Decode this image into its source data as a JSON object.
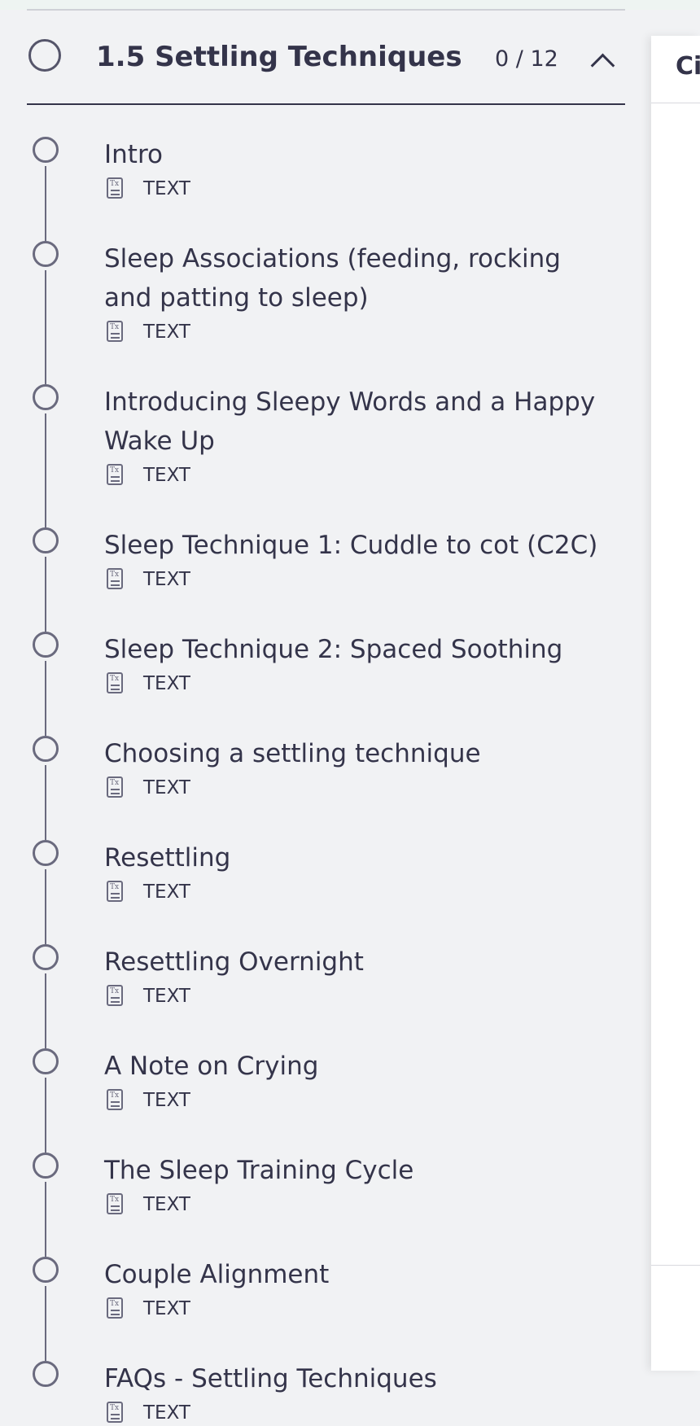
{
  "section": {
    "title": "1.5 Settling Techniques",
    "progress": "0 / 12",
    "progress_completed": 0,
    "progress_total": 12,
    "expanded": true
  },
  "right_panel": {
    "title_partial": "Ci"
  },
  "lessons": [
    {
      "title": "Intro",
      "type": "TEXT"
    },
    {
      "title": "Sleep Associations (feeding, rocking and patting to sleep)",
      "type": "TEXT"
    },
    {
      "title": "Introducing Sleepy Words and a Happy Wake Up",
      "type": "TEXT"
    },
    {
      "title": "Sleep Technique 1: Cuddle to cot (C2C)",
      "type": "TEXT"
    },
    {
      "title": "Sleep Technique 2: Spaced Soothing",
      "type": "TEXT"
    },
    {
      "title": "Choosing a settling technique",
      "type": "TEXT"
    },
    {
      "title": "Resettling",
      "type": "TEXT"
    },
    {
      "title": "Resettling Overnight",
      "type": "TEXT"
    },
    {
      "title": "A Note on Crying",
      "type": "TEXT"
    },
    {
      "title": "The Sleep Training Cycle",
      "type": "TEXT"
    },
    {
      "title": "Couple Alignment",
      "type": "TEXT"
    },
    {
      "title": "FAQs - Settling Techniques",
      "type": "TEXT"
    }
  ],
  "icons": {
    "section_status": "empty-circle-icon",
    "collapse": "chevron-up-icon",
    "lesson_status": "empty-circle-icon",
    "lesson_type": "text-document-icon"
  }
}
